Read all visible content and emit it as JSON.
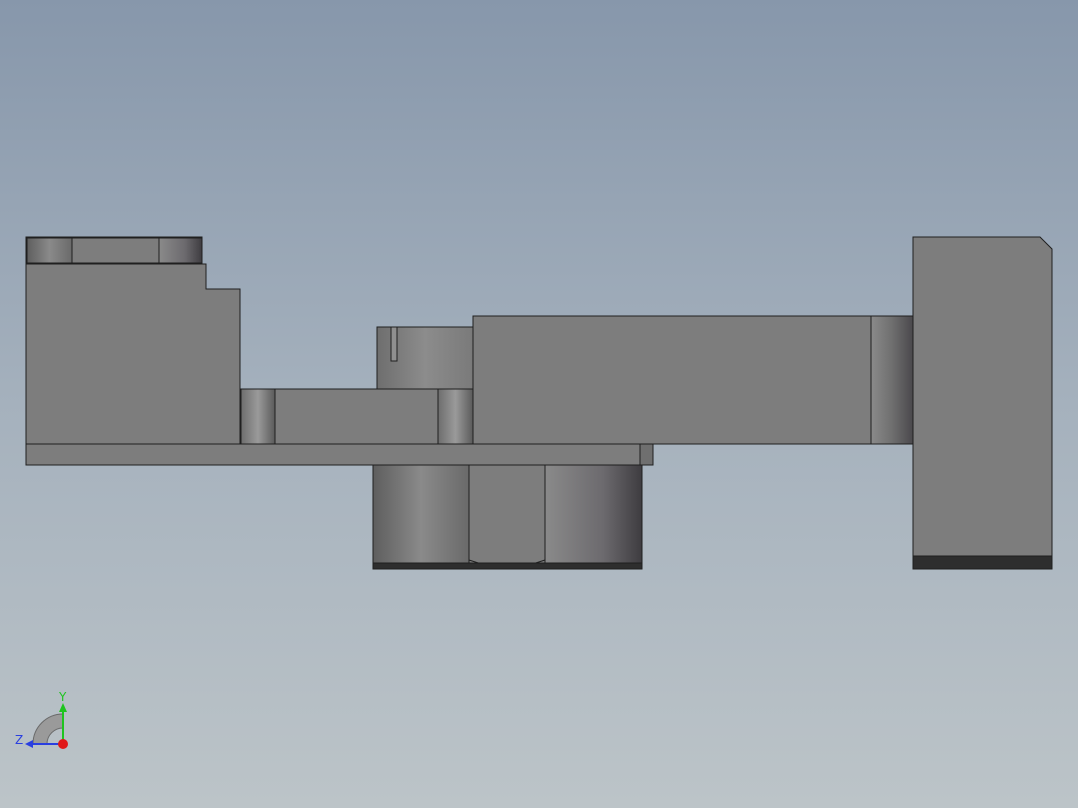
{
  "viewport": {
    "background_top": "#8797ab",
    "background_bottom": "#bcc4c8"
  },
  "model": {
    "face_color": "#7d7d7d",
    "edge_color": "#1f1f1f",
    "shadow_color": "#2e2e2e"
  },
  "triad": {
    "y_label": "Y",
    "z_label": "Z",
    "y_color": "#1fc41f",
    "z_color": "#2a3fe0",
    "x_color": "#e01818"
  }
}
